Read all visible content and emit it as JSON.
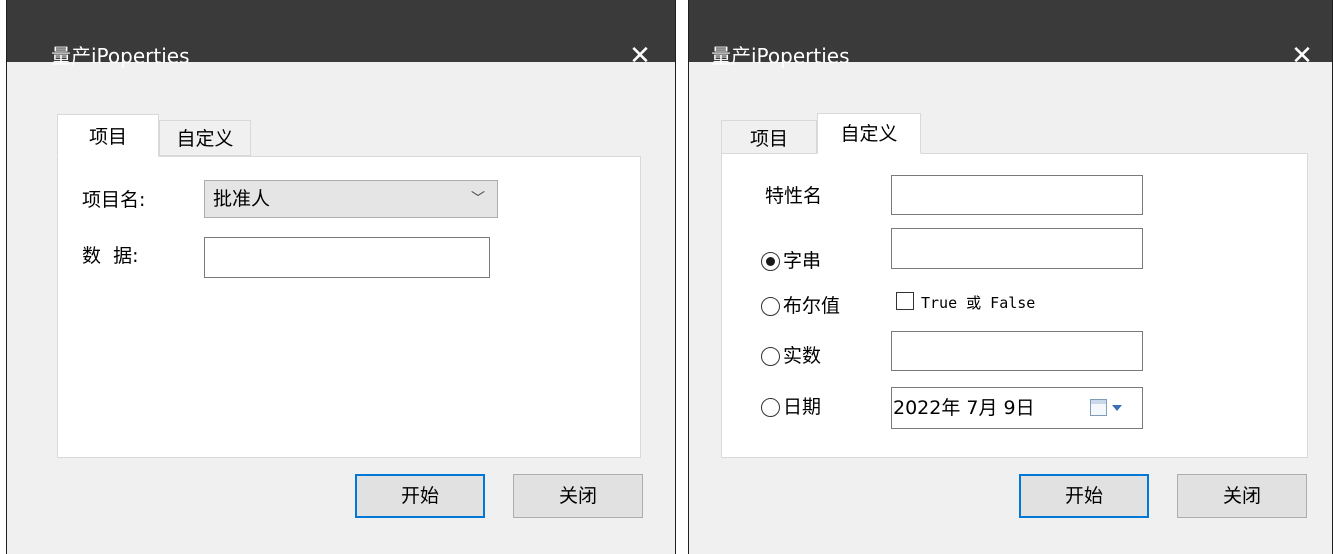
{
  "left_dialog": {
    "title": "量产iPoperties",
    "close_glyph": "✕",
    "tabs": [
      "项目",
      "自定义"
    ],
    "item_name_label": "项目名:",
    "item_name_value": "批准人",
    "data_label": "数  据:",
    "data_value": "",
    "start_button": "开始",
    "close_button": "关闭"
  },
  "right_dialog": {
    "title": "量产iPoperties",
    "close_glyph": "✕",
    "tabs": [
      "项目",
      "自定义"
    ],
    "property_name_label": "特性名",
    "property_name_value": "",
    "radio_string": "字串",
    "radio_string_checked": true,
    "string_value": "",
    "radio_boolean": "布尔值",
    "checkbox_label": "True 或 False",
    "checkbox_checked": false,
    "radio_number": "实数",
    "number_value": "",
    "radio_date": "日期",
    "date_value": "2022年 7月 9日",
    "start_button": "开始",
    "close_button": "关闭"
  }
}
